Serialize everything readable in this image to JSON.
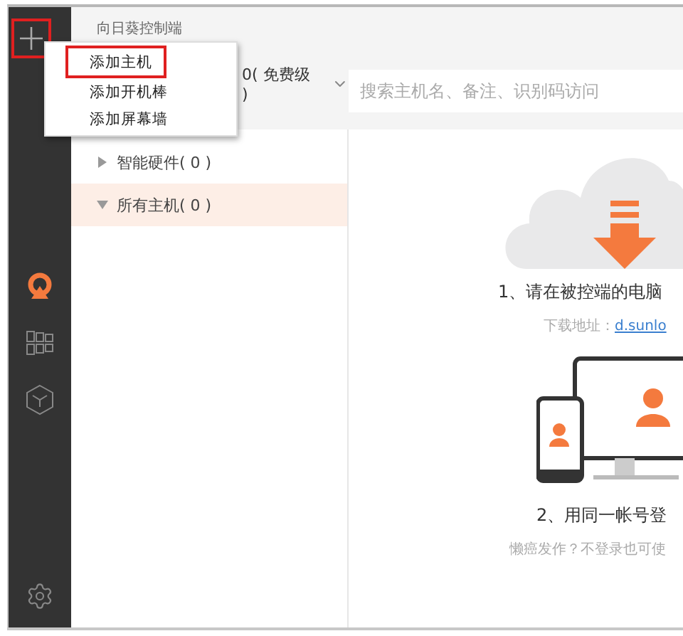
{
  "app_title": "向日葵控制端",
  "add_button": {
    "highlighted": true
  },
  "add_menu": {
    "items": [
      {
        "label": "添加主机",
        "highlighted": true
      },
      {
        "label": "添加开机棒",
        "highlighted": false
      },
      {
        "label": "添加屏幕墙",
        "highlighted": false
      }
    ]
  },
  "account": {
    "label": "0( 免费级 )"
  },
  "search": {
    "placeholder": "搜索主机名、备注、识别码访问"
  },
  "sidebar": {
    "items": [
      {
        "kind": "logo",
        "selected": true
      },
      {
        "kind": "grid",
        "selected": false
      },
      {
        "kind": "cube",
        "selected": false
      }
    ]
  },
  "tree": [
    {
      "label": "智能硬件( 0 )",
      "expanded": false,
      "selected": false
    },
    {
      "label": "所有主机( 0 )",
      "expanded": true,
      "selected": true
    }
  ],
  "steps": [
    {
      "title": "1、请在被控端的电脑",
      "hint": "下载地址：",
      "link": "d.sunlo"
    },
    {
      "title": "2、用同一帐号登",
      "hint": "懒癌发作？不登录也可使"
    }
  ]
}
